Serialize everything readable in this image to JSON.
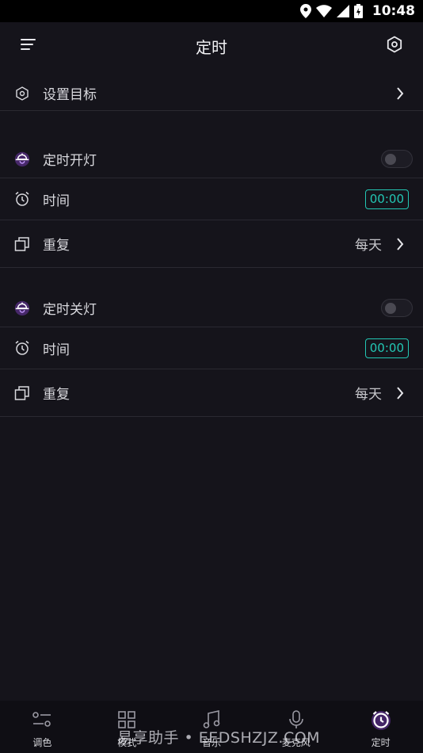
{
  "status_bar": {
    "time": "10:48"
  },
  "app_bar": {
    "title": "定时"
  },
  "target_row": {
    "label": "设置目标"
  },
  "on_section": {
    "header_label": "定时开灯",
    "enabled": false,
    "time_label": "时间",
    "time_value": "00:00",
    "repeat_label": "重复",
    "repeat_value": "每天"
  },
  "off_section": {
    "header_label": "定时关灯",
    "enabled": false,
    "time_label": "时间",
    "time_value": "00:00",
    "repeat_label": "重复",
    "repeat_value": "每天"
  },
  "bottom_nav": {
    "items": [
      {
        "label": "调色",
        "icon": "sliders-icon"
      },
      {
        "label": "模式",
        "icon": "grid-icon"
      },
      {
        "label": "音乐",
        "icon": "music-note-icon"
      },
      {
        "label": "麦克风",
        "icon": "microphone-icon"
      },
      {
        "label": "定时",
        "icon": "alarm-clock-icon",
        "active": true
      }
    ]
  },
  "watermark": "易享助手 • EEDSHZJZ.COM",
  "colors": {
    "background": "#15141b",
    "accent_teal": "#23c7b4",
    "accent_purple": "#a64dff"
  }
}
